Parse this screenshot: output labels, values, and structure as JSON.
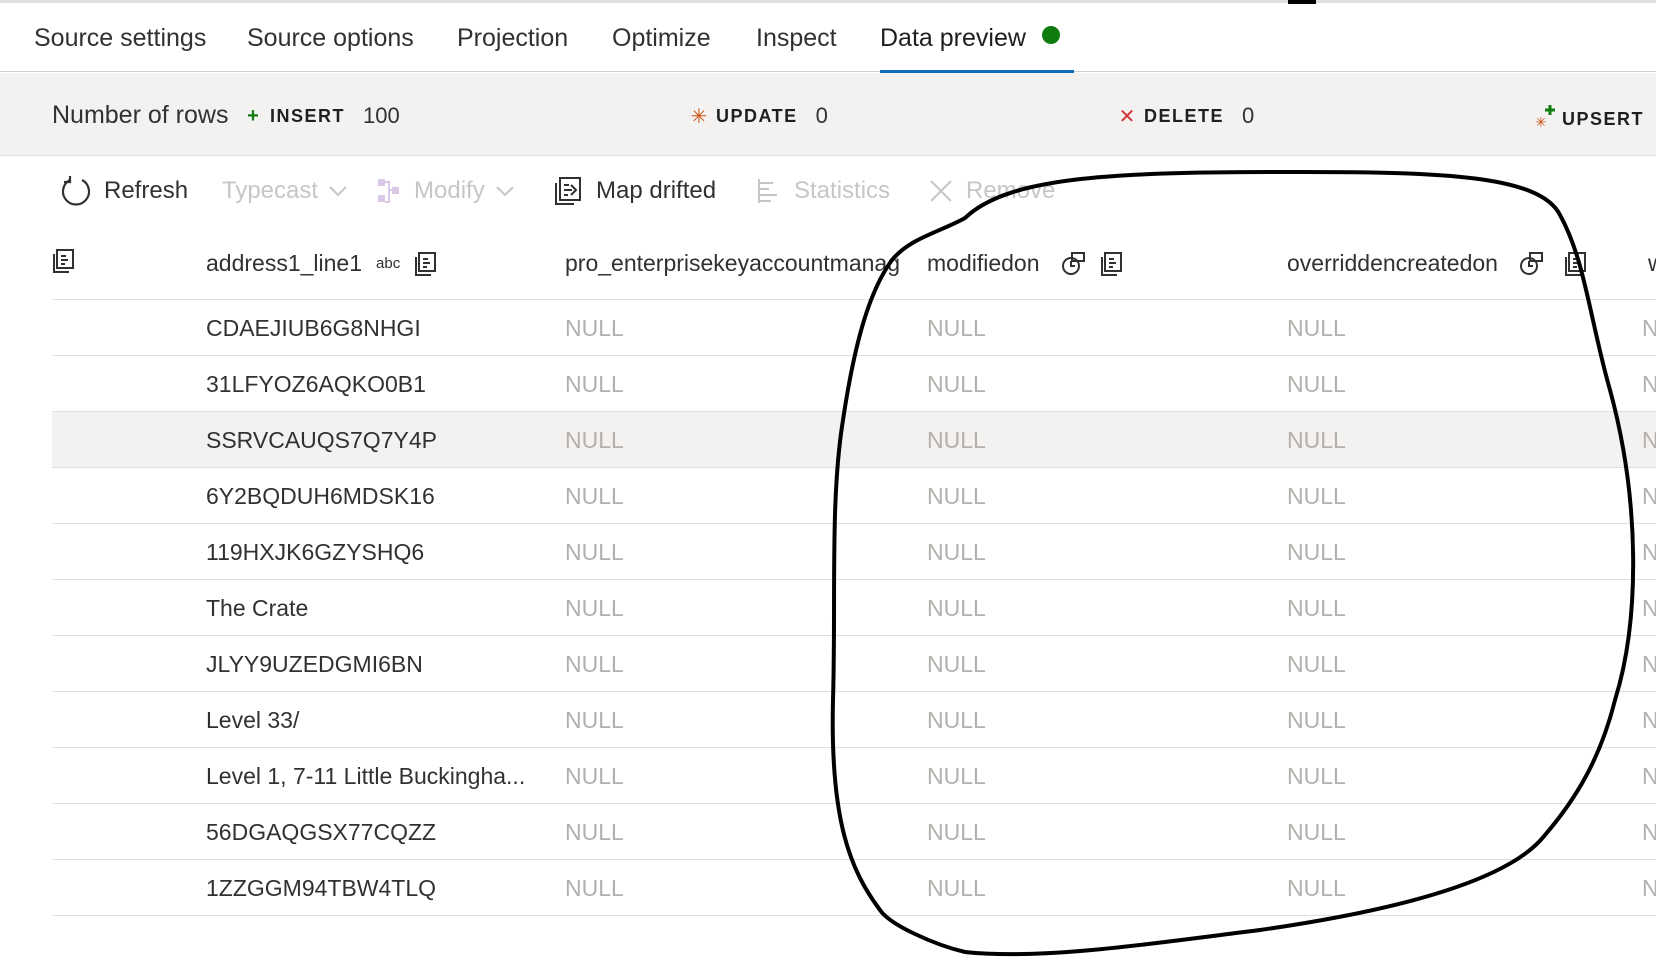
{
  "tabs": [
    {
      "label": "Source settings"
    },
    {
      "label": "Source options"
    },
    {
      "label": "Projection"
    },
    {
      "label": "Optimize"
    },
    {
      "label": "Inspect"
    },
    {
      "label": "Data preview",
      "active": true,
      "status_color": "#107c10"
    }
  ],
  "rows_bar": {
    "label": "Number of rows",
    "insert": {
      "label": "INSERT",
      "value": "100",
      "icon": "plus-icon",
      "color": "#107c10"
    },
    "update": {
      "label": "UPDATE",
      "value": "0",
      "icon": "asterisk-icon",
      "color": "#ca5010"
    },
    "delete": {
      "label": "DELETE",
      "value": "0",
      "icon": "x-icon",
      "color": "#d13438"
    },
    "upsert": {
      "label": "UPSERT",
      "icon": "upsert-icon"
    }
  },
  "toolbar": {
    "refresh": "Refresh",
    "typecast": "Typecast",
    "modify": "Modify",
    "map_drifted": "Map drifted",
    "statistics": "Statistics",
    "remove": "Remove"
  },
  "columns": {
    "c1": {
      "name": "address1_line1",
      "type": "abc"
    },
    "c2": {
      "name": "pro_enterprisekeyaccountmanag"
    },
    "c3": {
      "name": "modifiedon"
    },
    "c4": {
      "name": "overriddencreatedon"
    },
    "c5": {
      "name": "w"
    }
  },
  "rows": [
    {
      "addr": "CDAEJIUB6G8NHGI",
      "v": "NULL"
    },
    {
      "addr": "31LFYOZ6AQKO0B1",
      "v": "NULL"
    },
    {
      "addr": "SSRVCAUQS7Q7Y4P",
      "v": "NULL"
    },
    {
      "addr": "6Y2BQDUH6MDSK16",
      "v": "NULL"
    },
    {
      "addr": "119HXJK6GZYSHQ6",
      "v": "NULL"
    },
    {
      "addr": "The Crate",
      "v": "NULL"
    },
    {
      "addr": "JLYY9UZEDGMI6BN",
      "v": "NULL"
    },
    {
      "addr": "Level 33/",
      "v": "NULL"
    },
    {
      "addr": "Level 1, 7-11 Little Buckingha...",
      "v": "NULL"
    },
    {
      "addr": "56DGAQGSX77CQZZ",
      "v": "NULL"
    },
    {
      "addr": "1ZZGGM94TBW4TLQ",
      "v": "NULL"
    }
  ],
  "last_col_cell": "N"
}
